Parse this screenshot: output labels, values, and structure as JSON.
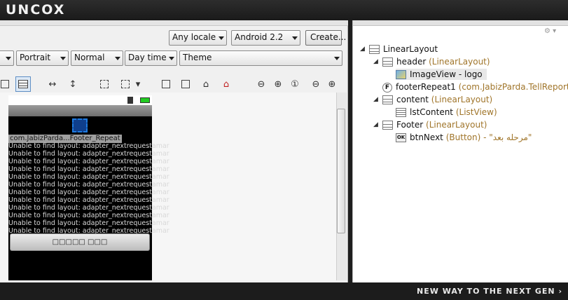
{
  "brand": "UNCOX",
  "tagline": "NEW WAY TO THE NEXT GEN ›",
  "toolbar_row1": {
    "locale": "Any locale",
    "platform": "Android 2.2",
    "create_label": "Create..."
  },
  "toolbar_row2": {
    "orientation": "Portrait",
    "mode": "Normal",
    "time": "Day time",
    "theme": "Theme"
  },
  "preview": {
    "repeat_label": "com.JabizParda...Footer_Repeat",
    "errors": [
      "Unable to find layout: adapter_nextrequestamar",
      "Unable to find layout: adapter_nextrequestamar",
      "Unable to find layout: adapter_nextrequestamar",
      "Unable to find layout: adapter_nextrequestamar",
      "Unable to find layout: adapter_nextrequestamar",
      "Unable to find layout: adapter_nextrequestamar",
      "Unable to find layout: adapter_nextrequestamar",
      "Unable to find layout: adapter_nextrequestamar",
      "Unable to find layout: adapter_nextrequestamar",
      "Unable to find layout: adapter_nextrequestamar",
      "Unable to find layout: adapter_nextrequestamar",
      "Unable to find layout: adapter_nextrequestamar"
    ],
    "button_label": "□□□□□ □□□"
  },
  "outline": [
    {
      "name": "LinearLayout",
      "type": "",
      "icon": "linear-layout-icon"
    },
    {
      "name": "header",
      "type": "(LinearLayout)",
      "icon": "linear-layout-icon"
    },
    {
      "name": "ImageView - logo",
      "type": "",
      "icon": "image-icon"
    },
    {
      "name": "footerRepeat1",
      "type": "(com.JabizParda.TellReport.Foot",
      "icon": "fragment-icon"
    },
    {
      "name": "content",
      "type": "(LinearLayout)",
      "icon": "linear-layout-icon"
    },
    {
      "name": "lstContent",
      "type": "(ListView)",
      "icon": "list-icon"
    },
    {
      "name": "Footer",
      "type": "(LinearLayout)",
      "icon": "linear-layout-icon"
    },
    {
      "name": "btnNext",
      "type": "(Button) - \"مرحله بعد\"",
      "icon": "button-icon"
    }
  ],
  "icon_glyphs": {
    "fragment": "F",
    "ok": "OK"
  },
  "colors": {
    "accent": "#1e7be0",
    "type_text": "#a0752a"
  }
}
